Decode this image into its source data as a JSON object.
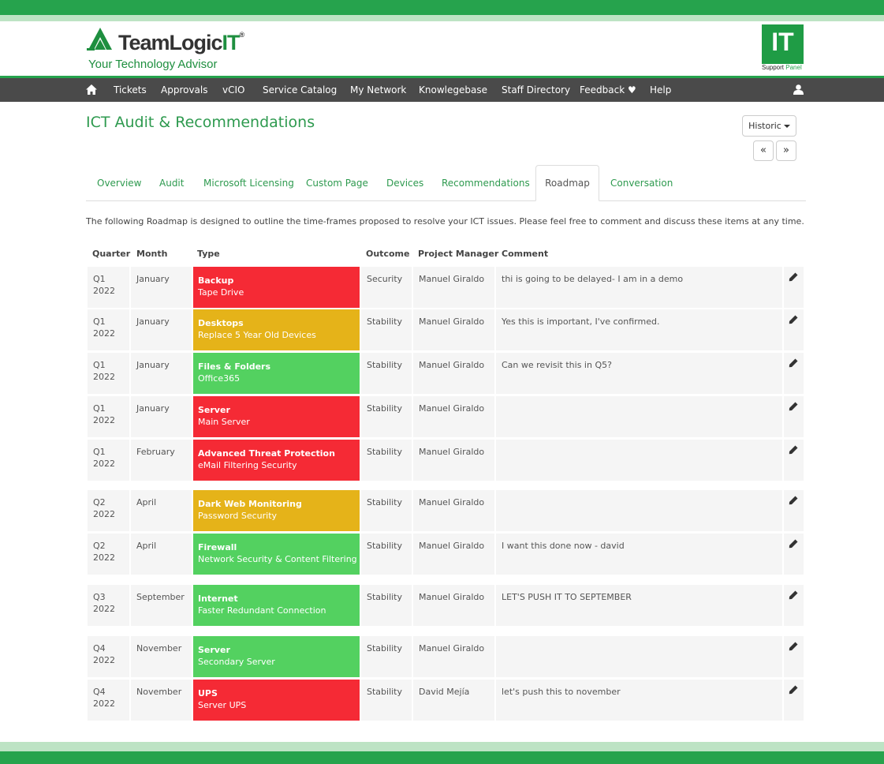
{
  "brand": {
    "logo_word": "TeamLogic",
    "logo_it": "IT",
    "logo_registered": "®",
    "tagline": "Your Technology Advisor",
    "panel_big": "IT",
    "panel_sub1": "Support",
    "panel_sub2": "Panel",
    "accent": "#26a34d"
  },
  "nav": {
    "items": [
      "Tickets",
      "Approvals",
      "vCIO",
      "Service Catalog",
      "My Network",
      "Knowlegebase",
      "Staff Directory",
      "Feedback ♥",
      "Help"
    ]
  },
  "page": {
    "title": "ICT Audit & Recommendations",
    "historic_label": "Historic",
    "prev_label": "«",
    "next_label": "»",
    "intro": "The following Roadmap is designed to outline the time-frames proposed to resolve your ICT issues. Please feel free to comment and discuss these items at any time."
  },
  "tabs": [
    "Overview",
    "Audit",
    "Microsoft Licensing",
    "Custom Page",
    "Devices",
    "Recommendations",
    "Roadmap",
    "Conversation"
  ],
  "active_tab": "Roadmap",
  "table": {
    "headers": [
      "Quarter",
      "Month",
      "Type",
      "Outcome",
      "Project Manager",
      "Comment"
    ],
    "rows": [
      {
        "quarter": "Q1",
        "year": "2022",
        "month": "January",
        "category": "Backup",
        "item": "Tape Drive",
        "color": "red",
        "outcome": "Security",
        "manager": "Manuel Giraldo",
        "comment": "thi is going to be delayed- I am in a demo"
      },
      {
        "quarter": "Q1",
        "year": "2022",
        "month": "January",
        "category": "Desktops",
        "item": "Replace 5 Year Old Devices",
        "color": "amber",
        "outcome": "Stability",
        "manager": "Manuel Giraldo",
        "comment": "Yes this is important, I've confirmed."
      },
      {
        "quarter": "Q1",
        "year": "2022",
        "month": "January",
        "category": "Files & Folders",
        "item": "Office365",
        "color": "green",
        "outcome": "Stability",
        "manager": "Manuel Giraldo",
        "comment": "Can we revisit this in Q5?"
      },
      {
        "quarter": "Q1",
        "year": "2022",
        "month": "January",
        "category": "Server",
        "item": "Main Server",
        "color": "red",
        "outcome": "Stability",
        "manager": "Manuel Giraldo",
        "comment": ""
      },
      {
        "quarter": "Q1",
        "year": "2022",
        "month": "February",
        "category": "Advanced Threat Protection",
        "item": "eMail Filtering Security",
        "color": "red",
        "outcome": "Stability",
        "manager": "Manuel Giraldo",
        "comment": ""
      },
      {
        "quarter": "Q2",
        "year": "2022",
        "month": "April",
        "category": "Dark Web Monitoring",
        "item": "Password Security",
        "color": "amber",
        "outcome": "Stability",
        "manager": "Manuel Giraldo",
        "comment": ""
      },
      {
        "quarter": "Q2",
        "year": "2022",
        "month": "April",
        "category": "Firewall",
        "item": "Network Security & Content Filtering",
        "color": "green",
        "outcome": "Stability",
        "manager": "Manuel Giraldo",
        "comment": "I want this done now - david"
      },
      {
        "quarter": "Q3",
        "year": "2022",
        "month": "September",
        "category": "Internet",
        "item": "Faster Redundant Connection",
        "color": "green",
        "outcome": "Stability",
        "manager": "Manuel Giraldo",
        "comment": "LET'S PUSH IT TO SEPTEMBER"
      },
      {
        "quarter": "Q4",
        "year": "2022",
        "month": "November",
        "category": "Server",
        "item": "Secondary Server",
        "color": "green",
        "outcome": "Stability",
        "manager": "Manuel Giraldo",
        "comment": ""
      },
      {
        "quarter": "Q4",
        "year": "2022",
        "month": "November",
        "category": "UPS",
        "item": "Server UPS",
        "color": "red",
        "outcome": "Stability",
        "manager": "David Mejía",
        "comment": "let's push this to november"
      }
    ]
  }
}
